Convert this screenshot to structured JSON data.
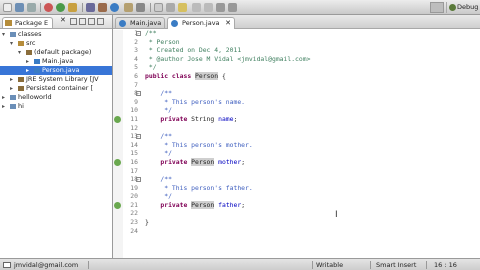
{
  "window": {
    "perspective": "Debug"
  },
  "package_explorer": {
    "tab_label": "Package E",
    "tree": [
      {
        "label": "classes",
        "indent": 0,
        "twisty": "▾",
        "icon": "project-icon",
        "color": "#6b8fb8"
      },
      {
        "label": "src",
        "indent": 1,
        "twisty": "▾",
        "icon": "source-folder-icon",
        "color": "#b58c3a"
      },
      {
        "label": "(default package)",
        "indent": 2,
        "twisty": "▾",
        "icon": "package-icon",
        "color": "#8a6d3b"
      },
      {
        "label": "Main.java",
        "indent": 3,
        "twisty": "▸",
        "icon": "java-file-icon",
        "color": "#3a7cc4"
      },
      {
        "label": "Person.java",
        "indent": 3,
        "twisty": "▸",
        "icon": "java-file-icon",
        "color": "#3a7cc4",
        "selected": true
      },
      {
        "label": "JRE System Library [JV",
        "indent": 1,
        "twisty": "▸",
        "icon": "library-icon",
        "color": "#8a6d3b"
      },
      {
        "label": "Persisted container [",
        "indent": 1,
        "twisty": "▸",
        "icon": "library-icon",
        "color": "#8a6d3b"
      },
      {
        "label": "helloworld",
        "indent": 0,
        "twisty": "▸",
        "icon": "project-icon",
        "color": "#6b8fb8"
      },
      {
        "label": "hi",
        "indent": 0,
        "twisty": "▸",
        "icon": "project-icon",
        "color": "#6b8fb8"
      }
    ]
  },
  "editor": {
    "tabs": [
      {
        "label": "Main.java",
        "active": false
      },
      {
        "label": "Person.java",
        "active": true
      }
    ],
    "lines": [
      {
        "n": "1",
        "fold": "⊖",
        "parts": [
          [
            "cm",
            "/**"
          ]
        ]
      },
      {
        "n": "2",
        "parts": [
          [
            "cm",
            " * Person"
          ]
        ]
      },
      {
        "n": "3",
        "parts": [
          [
            "cm",
            " * Created on Dec 4, 2011"
          ]
        ]
      },
      {
        "n": "4",
        "parts": [
          [
            "cm",
            " * @author Jose M Vidal <jmvidal@gmail.com>"
          ]
        ]
      },
      {
        "n": "5",
        "parts": [
          [
            "cm",
            " */"
          ]
        ]
      },
      {
        "n": "6",
        "parts": [
          [
            "kw",
            "public class "
          ],
          [
            "hl",
            "Person"
          ],
          [
            "",
            " {"
          ]
        ]
      },
      {
        "n": "7",
        "parts": []
      },
      {
        "n": "8",
        "fold": "⊖",
        "parts": [
          [
            "jd",
            "    /**"
          ]
        ]
      },
      {
        "n": "9",
        "parts": [
          [
            "jd",
            "     * This person's name."
          ]
        ]
      },
      {
        "n": "10",
        "parts": [
          [
            "jd",
            "     */"
          ]
        ]
      },
      {
        "n": "11",
        "marker": true,
        "parts": [
          [
            "kw",
            "    private "
          ],
          [
            "",
            "String "
          ],
          [
            "fld",
            "name"
          ],
          [
            "",
            ";"
          ]
        ]
      },
      {
        "n": "12",
        "parts": []
      },
      {
        "n": "13",
        "fold": "⊖",
        "parts": [
          [
            "jd",
            "    /**"
          ]
        ]
      },
      {
        "n": "14",
        "parts": [
          [
            "jd",
            "     * This person's mother."
          ]
        ]
      },
      {
        "n": "15",
        "parts": [
          [
            "jd",
            "     */"
          ]
        ]
      },
      {
        "n": "16",
        "marker": true,
        "parts": [
          [
            "kw",
            "    private "
          ],
          [
            "hl",
            "Person"
          ],
          [
            "",
            " "
          ],
          [
            "fld",
            "mother"
          ],
          [
            "",
            ";"
          ]
        ]
      },
      {
        "n": "17",
        "parts": []
      },
      {
        "n": "18",
        "fold": "⊖",
        "parts": [
          [
            "jd",
            "    /**"
          ]
        ]
      },
      {
        "n": "19",
        "parts": [
          [
            "jd",
            "     * This person's father."
          ]
        ]
      },
      {
        "n": "20",
        "parts": [
          [
            "jd",
            "     */"
          ]
        ]
      },
      {
        "n": "21",
        "marker": true,
        "parts": [
          [
            "kw",
            "    private "
          ],
          [
            "hl",
            "Person"
          ],
          [
            "",
            " "
          ],
          [
            "fld",
            "father"
          ],
          [
            "",
            ";"
          ]
        ]
      },
      {
        "n": "22",
        "parts": []
      },
      {
        "n": "23",
        "parts": [
          [
            "",
            "}"
          ]
        ]
      },
      {
        "n": "24",
        "parts": []
      }
    ]
  },
  "status_bar": {
    "user": "jmvidal@gmail.com",
    "writable": "Writable",
    "insert_mode": "Smart Insert",
    "position": "16 : 16"
  }
}
